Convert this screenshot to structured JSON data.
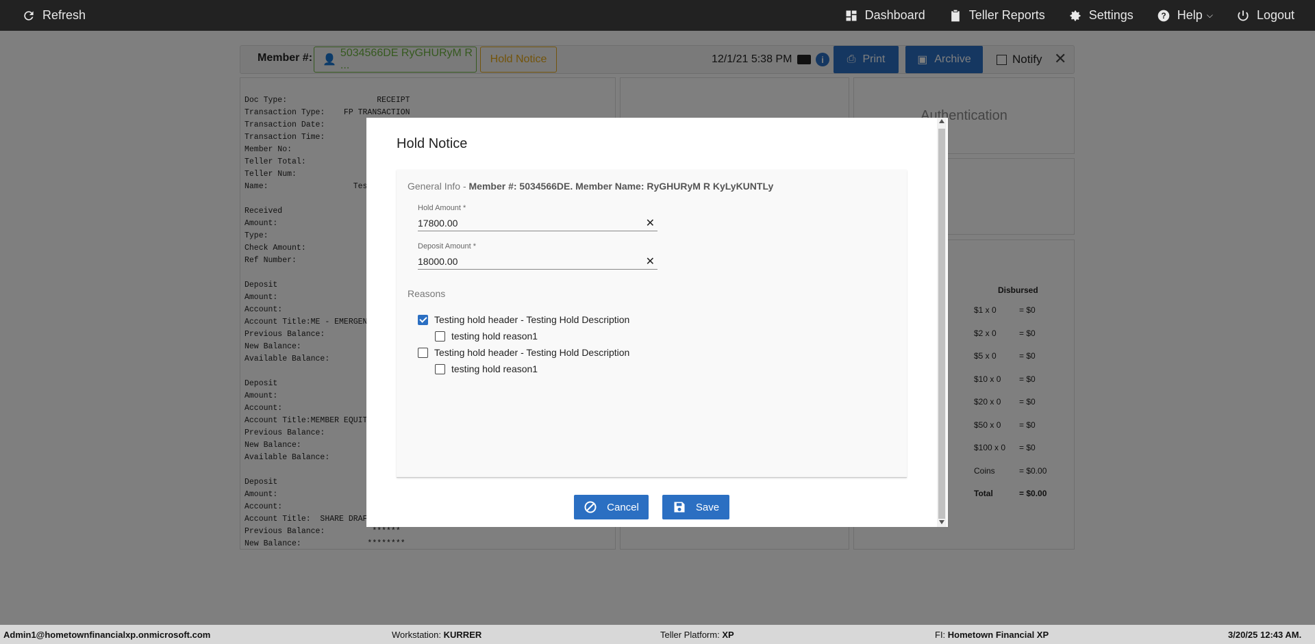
{
  "topbar": {
    "refresh": "Refresh",
    "dashboard": "Dashboard",
    "teller_reports": "Teller Reports",
    "settings": "Settings",
    "help": "Help",
    "logout": "Logout"
  },
  "member_bar": {
    "label": "Member #:",
    "member_chip": "5034566DE RyGHURyM R ...",
    "hold_notice": "Hold Notice",
    "datetime": "12/1/21 5:38 PM",
    "info": "i",
    "print": "Print",
    "archive": "Archive",
    "notify": "Notify",
    "close": "✕"
  },
  "receipt_text": "Doc Type:                   RECEIPT\nTransaction Type:    FP TRANSACTION\nTransaction Date:\nTransaction Time:\nMember No:                *\nTeller Total:\nTeller Num:\nName:                  Tes\n\nReceived\nAmount:\nType:                     IN\nCheck Amount:             18\nRef Number:\n\nDeposit\nAmount:\nAccount:                  *\nAccount Title:ME - EMERGENC\nPrevious Balance:\nNew Balance:\nAvailable Balance:\n\nDeposit\nAmount:\nAccount:                  *\nAccount Title:MEMBER EQUITY\nPrevious Balance:\nNew Balance:\nAvailable Balance:\n\nDeposit\nAmount:\nAccount:                  *\nAccount Title:  SHARE DRAFT\nPrevious Balance:          ******\nNew Balance:              ********",
  "auth_title": "Authentication",
  "cash": {
    "header": "Disbursed",
    "rows": [
      {
        "denom": "$1 x 0",
        "amount": "= $0"
      },
      {
        "denom": "$2 x 0",
        "amount": "= $0"
      },
      {
        "denom": "$5 x 0",
        "amount": "= $0"
      },
      {
        "denom": "$10 x 0",
        "amount": "= $0"
      },
      {
        "denom": "$20 x 0",
        "amount": "= $0"
      },
      {
        "denom": "$50 x 0",
        "amount": "= $0"
      },
      {
        "denom": "$100 x 0",
        "amount": "= $0"
      },
      {
        "denom": "Coins",
        "amount": "= $0.00"
      },
      {
        "denom": "Total",
        "amount": "= $0.00"
      }
    ]
  },
  "modal": {
    "title": "Hold Notice",
    "general_info_prefix": "General Info -",
    "general_info_detail": "Member #: 5034566DE. Member Name: RyGHURyM R KyLyKUNTLy",
    "hold_amount_label": "Hold Amount *",
    "hold_amount_value": "17800.00",
    "deposit_amount_label": "Deposit Amount *",
    "deposit_amount_value": "18000.00",
    "clear_glyph": "✕",
    "reasons_label": "Reasons",
    "reasons": [
      {
        "label": "Testing hold header - Testing Hold Description",
        "checked": true,
        "sub": "testing hold reason1",
        "sub_checked": false
      },
      {
        "label": "Testing hold header - Testing Hold Description",
        "checked": false,
        "sub": "testing hold reason1",
        "sub_checked": false
      }
    ],
    "cancel": "Cancel",
    "save": "Save"
  },
  "statusbar": {
    "user": "Admin1@hometownfinancialxp.onmicrosoft.com",
    "workstation_label": "Workstation:",
    "workstation": "KURRER",
    "platform_label": "Teller Platform:",
    "platform": "XP",
    "fi_label": "FI:",
    "fi": "Hometown Financial XP",
    "datetime": "3/20/25 12:43 AM."
  },
  "colors": {
    "primary": "#2b6fc2",
    "member_green": "#6cb33f",
    "hold_orange": "#e6a817",
    "topbar": "#222222"
  }
}
